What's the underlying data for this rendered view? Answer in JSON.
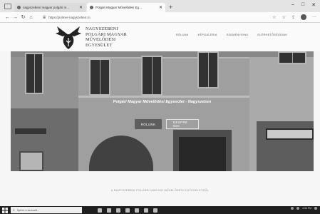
{
  "browser": {
    "tabs": [
      {
        "title": "nagyszebeni magyar polgári m...",
        "active": false
      },
      {
        "title": "Polgári Magyar Művelődési Eg...",
        "active": true
      }
    ],
    "new_tab_glyph": "+",
    "window_controls": [
      "–",
      "□",
      "✕"
    ],
    "url": "https://polmer-nagyszeben.ro",
    "nav_glyphs": {
      "back": "←",
      "forward": "→",
      "refresh": "↻",
      "home": "⌂"
    },
    "toolbar_glyphs": {
      "favorite": "☆",
      "collections": "☆",
      "share": "⇪",
      "menu": "···"
    }
  },
  "site": {
    "name_lines": [
      "NAGYSZEBENI",
      "POLGÁRI MAGYAR",
      "MŰVELŐDÉSI",
      "EGYESÜLET"
    ],
    "nav": [
      "RÓLUNK",
      "KÉPGALÉRIA",
      "ESEMÉNYEINK",
      "ELÉRHETŐSÉGEINK"
    ],
    "hero": {
      "title": "Polgári Magyar Művelődési Egyesület - Nagyszeben",
      "buttons": [
        "RÓLUNK",
        "DESPRE NOI"
      ]
    },
    "about_caption": "A NAGYSZEBENI POLGÁRI MAGYAR MŰVELŐDÉSI EGYESÜLETRŐL"
  },
  "taskbar": {
    "search_placeholder": "Írja be a keresett...",
    "time": "4:34 PM"
  },
  "colors": {
    "hero_bg": "#8e8e8e",
    "taskbar": "#1f1f1f"
  }
}
